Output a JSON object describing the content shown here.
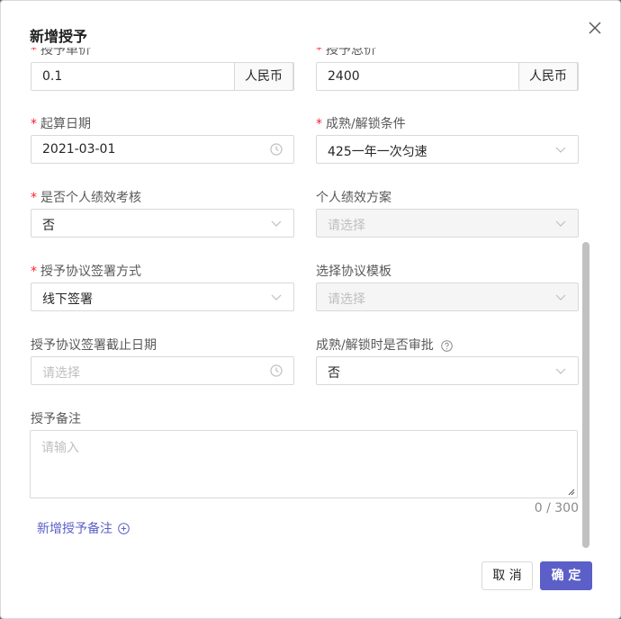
{
  "modal": {
    "title": "新增授予",
    "cancel_label": "取 消",
    "ok_label": "确 定"
  },
  "fields": {
    "unit_price": {
      "label": "授予单价",
      "value": "0.1",
      "addon": "人民币"
    },
    "total_price": {
      "label": "授予总价",
      "value": "2400",
      "addon": "人民币"
    },
    "start_date": {
      "label": "起算日期",
      "value": "2021-03-01"
    },
    "vesting_condition": {
      "label": "成熟/解锁条件",
      "value": "425一年一次匀速"
    },
    "performance_review": {
      "label": "是否个人绩效考核",
      "value": "否"
    },
    "performance_plan": {
      "label": "个人绩效方案",
      "placeholder": "请选择"
    },
    "sign_method": {
      "label": "授予协议签署方式",
      "value": "线下签署"
    },
    "agreement_template": {
      "label": "选择协议模板",
      "placeholder": "请选择"
    },
    "sign_deadline": {
      "label": "授予协议签署截止日期",
      "placeholder": "请选择"
    },
    "vesting_approval": {
      "label": "成熟/解锁时是否审批",
      "value": "否"
    },
    "note": {
      "label": "授予备注",
      "placeholder": "请输入",
      "counter": "0 / 300"
    }
  },
  "add_note_label": "新增授予备注",
  "required_mark": "*",
  "colors": {
    "primary": "#5b5fc7",
    "required": "#f5222d"
  }
}
